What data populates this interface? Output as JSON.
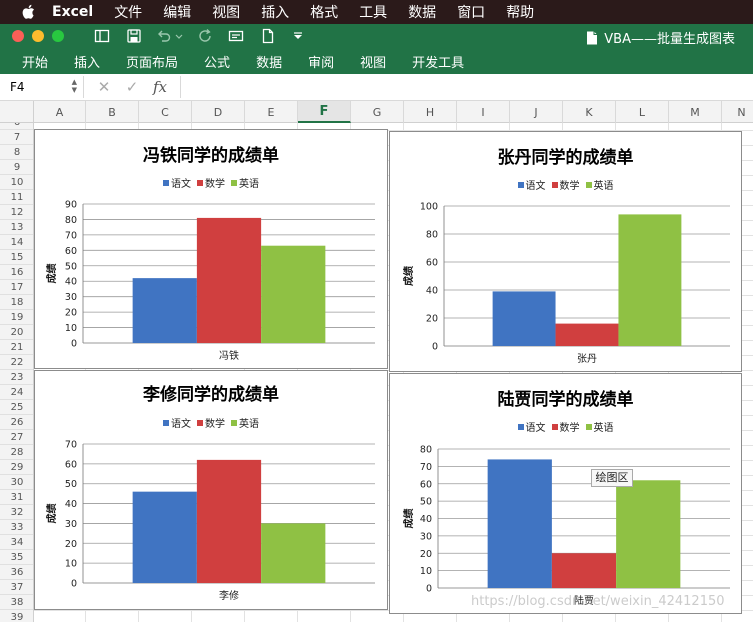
{
  "menubar": {
    "apple_icon": "apple-logo-icon",
    "items": [
      "Excel",
      "文件",
      "编辑",
      "视图",
      "插入",
      "格式",
      "工具",
      "数据",
      "窗口",
      "帮助"
    ]
  },
  "titlebar": {
    "doc_title": "VBA——批量生成图表",
    "colors": {
      "bar": "#217346"
    }
  },
  "ribbon": {
    "tabs": [
      "开始",
      "插入",
      "页面布局",
      "公式",
      "数据",
      "审阅",
      "视图",
      "开发工具"
    ]
  },
  "formula_bar": {
    "name_box": "F4",
    "cancel_glyph": "✕",
    "enter_glyph": "✓",
    "fx_label": "fx",
    "formula": ""
  },
  "sheet": {
    "columns": [
      "A",
      "B",
      "C",
      "D",
      "E",
      "F",
      "G",
      "H",
      "I",
      "J",
      "K",
      "L",
      "M",
      "N"
    ],
    "selected_column": "F",
    "rows": [
      "6",
      "7",
      "8",
      "9",
      "10",
      "11",
      "12",
      "13",
      "14",
      "15",
      "16",
      "17",
      "18",
      "19",
      "20",
      "21",
      "22",
      "23",
      "24",
      "25",
      "26",
      "27",
      "28",
      "29",
      "30",
      "31",
      "32",
      "33",
      "34",
      "35",
      "36",
      "37",
      "38",
      "39"
    ]
  },
  "chart_data": [
    {
      "type": "bar",
      "title": "冯铁同学的成绩单",
      "categories": [
        "冯铁"
      ],
      "series": [
        {
          "name": "语文",
          "values": [
            42
          ]
        },
        {
          "name": "数学",
          "values": [
            81
          ]
        },
        {
          "name": "英语",
          "values": [
            63
          ]
        }
      ],
      "ylabel": "成绩",
      "ylim": [
        0,
        90
      ],
      "yticks": [
        0,
        10,
        20,
        30,
        40,
        50,
        60,
        70,
        80,
        90
      ],
      "legend": "top",
      "grid": true
    },
    {
      "type": "bar",
      "title": "张丹同学的成绩单",
      "categories": [
        "张丹"
      ],
      "series": [
        {
          "name": "语文",
          "values": [
            39
          ]
        },
        {
          "name": "数学",
          "values": [
            16
          ]
        },
        {
          "name": "英语",
          "values": [
            94
          ]
        }
      ],
      "ylabel": "成绩",
      "ylim": [
        0,
        100
      ],
      "yticks": [
        0,
        20,
        40,
        60,
        80,
        100
      ],
      "legend": "top",
      "grid": true
    },
    {
      "type": "bar",
      "title": "李修同学的成绩单",
      "categories": [
        "李修"
      ],
      "series": [
        {
          "name": "语文",
          "values": [
            46
          ]
        },
        {
          "name": "数学",
          "values": [
            62
          ]
        },
        {
          "name": "英语",
          "values": [
            30
          ]
        }
      ],
      "ylabel": "成绩",
      "ylim": [
        0,
        70
      ],
      "yticks": [
        0,
        10,
        20,
        30,
        40,
        50,
        60,
        70
      ],
      "legend": "top",
      "grid": true
    },
    {
      "type": "bar",
      "title": "陆贾同学的成绩单",
      "categories": [
        "陆贾"
      ],
      "series": [
        {
          "name": "语文",
          "values": [
            74
          ]
        },
        {
          "name": "数学",
          "values": [
            20
          ]
        },
        {
          "name": "英语",
          "values": [
            62
          ]
        }
      ],
      "ylabel": "成绩",
      "ylim": [
        0,
        80
      ],
      "yticks": [
        0,
        10,
        20,
        30,
        40,
        50,
        60,
        70,
        80
      ],
      "legend": "top",
      "grid": true
    }
  ],
  "series_colors": [
    "#4074c2",
    "#d03f3f",
    "#8fc144"
  ],
  "tooltip": {
    "text": "绘图区"
  },
  "watermark": {
    "text": "https://blog.csdn.net/weixin_42412150"
  }
}
